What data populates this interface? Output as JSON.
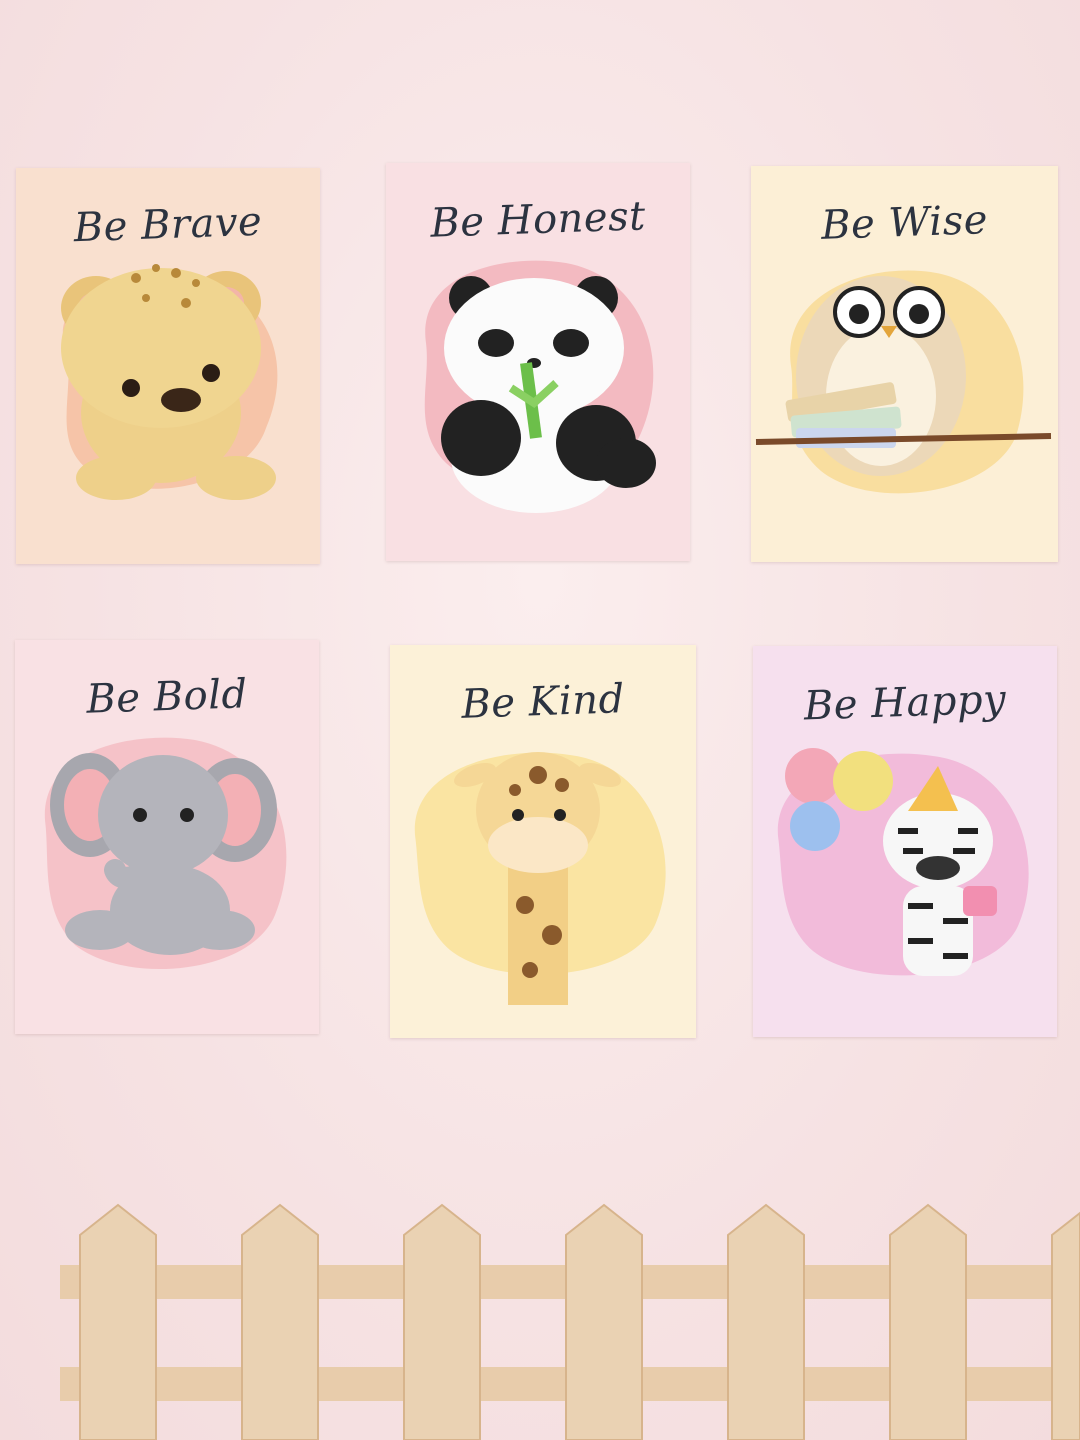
{
  "posters": [
    {
      "caption": "Be Brave",
      "animal": "leopard-cub",
      "bg": "#f9dcc9",
      "blob": "#f4b08e"
    },
    {
      "caption": "Be Honest",
      "animal": "panda",
      "bg": "#f8dde1",
      "blob": "#ee9aa6"
    },
    {
      "caption": "Be Wise",
      "animal": "owl",
      "bg": "#fbeccd",
      "blob": "#f6cf73"
    },
    {
      "caption": "Be Bold",
      "animal": "elephant",
      "bg": "#f8dde0",
      "blob": "#f2a9b0"
    },
    {
      "caption": "Be Kind",
      "animal": "giraffe",
      "bg": "#fcefd0",
      "blob": "#f7d876"
    },
    {
      "caption": "Be Happy",
      "animal": "zebra",
      "bg": "#f4dde9",
      "blob": "#ee9ccb"
    }
  ]
}
